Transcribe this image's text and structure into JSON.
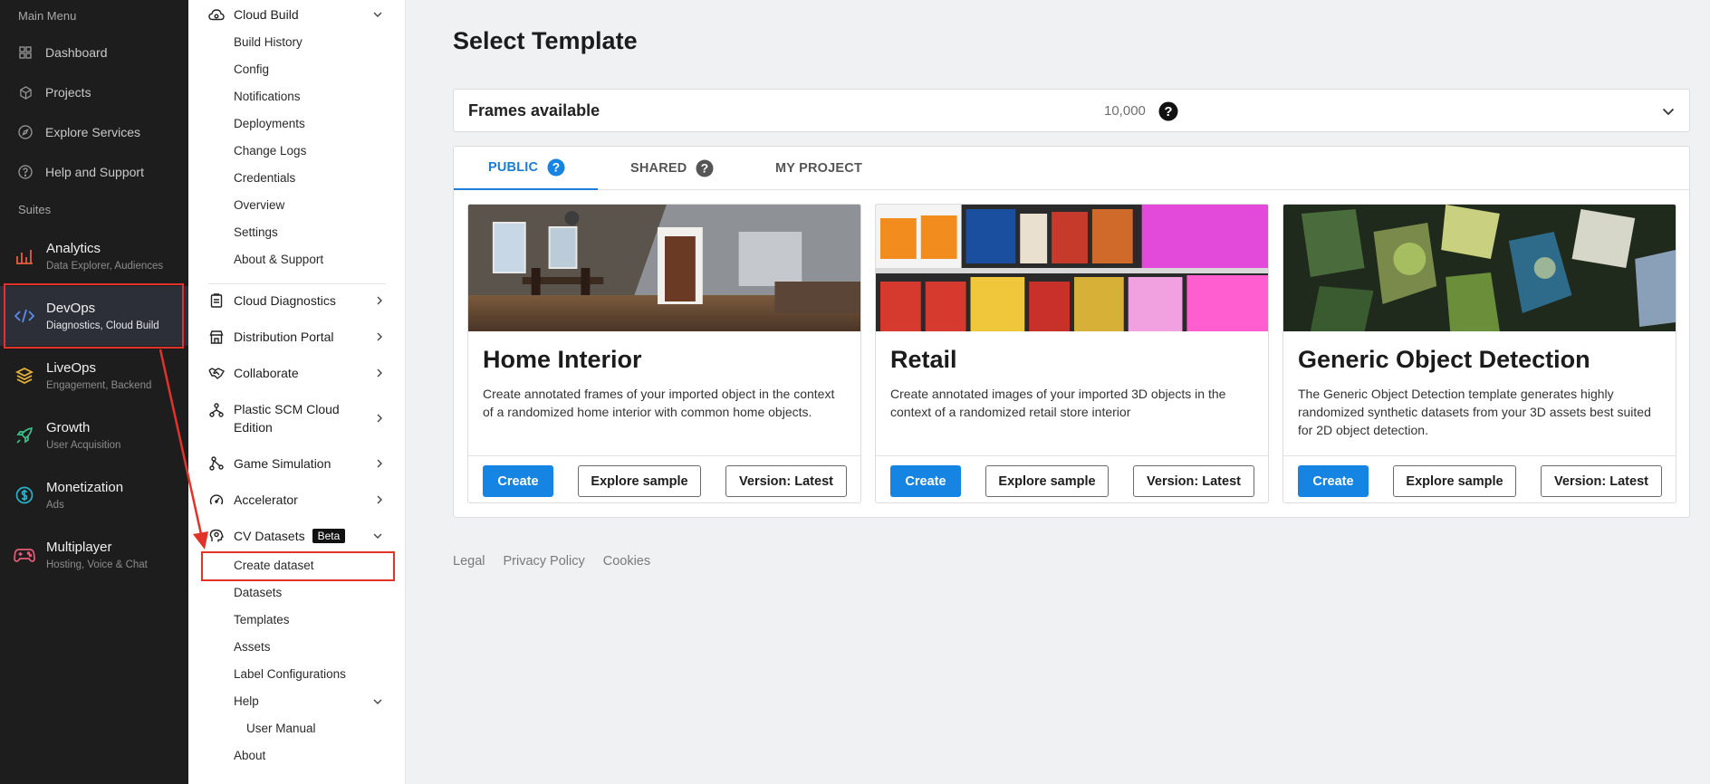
{
  "rail": {
    "main_menu_title": "Main Menu",
    "items": [
      {
        "label": "Dashboard",
        "icon": "grid-icon"
      },
      {
        "label": "Projects",
        "icon": "cube-icon"
      },
      {
        "label": "Explore Services",
        "icon": "compass-icon"
      },
      {
        "label": "Help and Support",
        "icon": "help-circle-icon"
      }
    ],
    "suites_title": "Suites",
    "suites": [
      {
        "title": "Analytics",
        "subtitle": "Data Explorer, Audiences",
        "icon": "bar-chart-icon",
        "color": "#e85d3c"
      },
      {
        "title": "DevOps",
        "subtitle": "Diagnostics, Cloud Build",
        "icon": "code-icon",
        "color": "#5b8de6"
      },
      {
        "title": "LiveOps",
        "subtitle": "Engagement, Backend",
        "icon": "layers-icon",
        "color": "#e8b43c"
      },
      {
        "title": "Growth",
        "subtitle": "User Acquisition",
        "icon": "rocket-icon",
        "color": "#3cc08a"
      },
      {
        "title": "Monetization",
        "subtitle": "Ads",
        "icon": "dollar-circle-icon",
        "color": "#28b3c9"
      },
      {
        "title": "Multiplayer",
        "subtitle": "Hosting, Voice & Chat",
        "icon": "gamepad-icon",
        "color": "#e85c7a"
      }
    ]
  },
  "subnav": {
    "cloud_build": "Cloud Build",
    "cloud_build_items": [
      "Build History",
      "Config",
      "Notifications",
      "Deployments",
      "Change Logs",
      "Credentials",
      "Overview",
      "Settings",
      "About & Support"
    ],
    "groups": [
      "Cloud Diagnostics",
      "Distribution Portal",
      "Collaborate",
      "Plastic SCM Cloud Edition",
      "Game Simulation",
      "Accelerator"
    ],
    "cv_datasets": "CV Datasets",
    "cv_badge": "Beta",
    "cv_items": [
      "Create dataset",
      "Datasets",
      "Templates",
      "Assets",
      "Label Configurations"
    ],
    "help": "Help",
    "user_manual": "User Manual",
    "about": "About"
  },
  "main": {
    "title": "Select Template",
    "frames_label": "Frames available",
    "frames_value": "10,000",
    "tabs": [
      "PUBLIC",
      "SHARED",
      "MY PROJECT"
    ],
    "cards": [
      {
        "title": "Home Interior",
        "description": "Create annotated frames of your imported object in the context of a randomized home interior with common home objects.",
        "create": "Create",
        "explore": "Explore sample",
        "version": "Version: Latest"
      },
      {
        "title": "Retail",
        "description": "Create annotated images of your imported 3D objects in the context of a randomized retail store interior",
        "create": "Create",
        "explore": "Explore sample",
        "version": "Version: Latest"
      },
      {
        "title": "Generic Object Detection",
        "description": "The Generic Object Detection template generates highly randomized synthetic datasets from your 3D assets best suited for 2D object detection.",
        "create": "Create",
        "explore": "Explore sample",
        "version": "Version: Latest"
      }
    ],
    "footer_links": [
      "Legal",
      "Privacy Policy",
      "Cookies"
    ]
  },
  "colors": {
    "accent": "#1684e3",
    "annotation": "#e2332a",
    "rail_bg": "#1d1d1d"
  }
}
